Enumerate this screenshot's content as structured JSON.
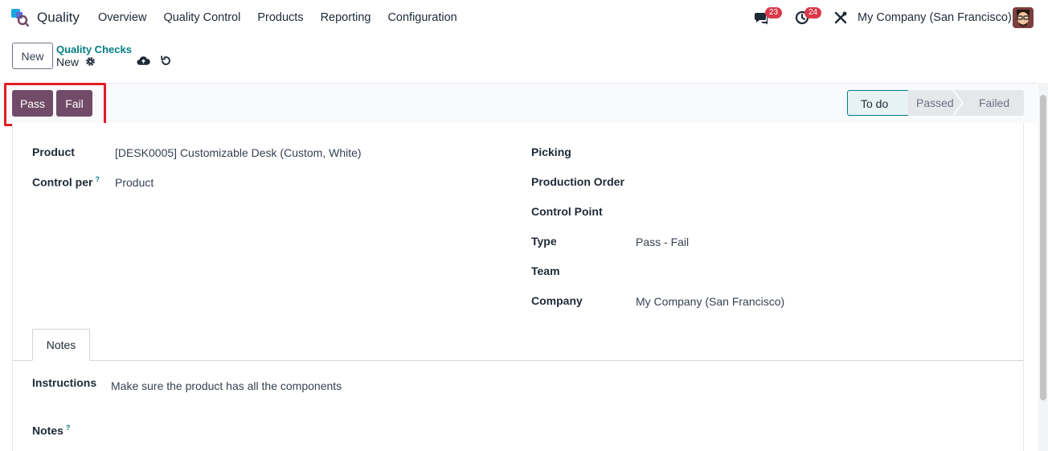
{
  "navbar": {
    "app_name": "Quality",
    "menu": [
      "Overview",
      "Quality Control",
      "Products",
      "Reporting",
      "Configuration"
    ],
    "chat_badge": "23",
    "activity_badge": "24",
    "company": "My Company (San Francisco)"
  },
  "control_panel": {
    "new_label": "New",
    "breadcrumb": "Quality Checks",
    "record_name": "New"
  },
  "statusbar": {
    "pass_label": "Pass",
    "fail_label": "Fail",
    "stages": [
      "To do",
      "Passed",
      "Failed"
    ],
    "active_stage": "To do"
  },
  "form": {
    "left": {
      "product_label": "Product",
      "product_value": "[DESK0005] Customizable Desk (Custom, White)",
      "control_per_label": "Control per",
      "control_per_help": "?",
      "control_per_value": "Product"
    },
    "right": {
      "picking_label": "Picking",
      "production_order_label": "Production Order",
      "control_point_label": "Control Point",
      "type_label": "Type",
      "type_value": "Pass - Fail",
      "team_label": "Team",
      "company_label": "Company",
      "company_value": "My Company (San Francisco)"
    },
    "tabs": [
      "Notes"
    ],
    "notes_tab": {
      "instructions_label": "Instructions",
      "instructions_value": "Make sure the product has all the components",
      "notes_label": "Notes",
      "notes_help": "?"
    }
  },
  "colors": {
    "primary": "#714b67",
    "accent": "#017e84",
    "badge": "#d93a4a",
    "highlight": "#e11d24"
  }
}
